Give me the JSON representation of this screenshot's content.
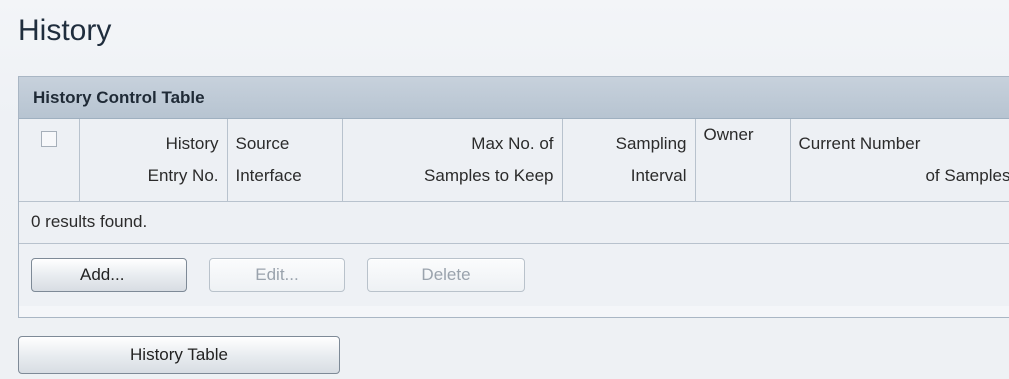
{
  "page": {
    "title": "History"
  },
  "panel": {
    "header": "History Control Table",
    "columns": [
      {
        "line1": "History",
        "line2": "Entry No."
      },
      {
        "line1": "Source",
        "line2": "Interface"
      },
      {
        "line1": "Max No. of",
        "line2": "Samples to Keep"
      },
      {
        "line1": "Sampling",
        "line2": "Interval"
      },
      {
        "line1": "Owner",
        "line2": ""
      },
      {
        "line1": "Current Number",
        "line2": "of Samples"
      }
    ],
    "results_text": "0 results found.",
    "buttons": {
      "add": "Add...",
      "edit": "Edit...",
      "delete": "Delete"
    }
  },
  "footer": {
    "history_table_button": "History Table"
  },
  "colors": {
    "panel_header_bg": "#b7c4d1",
    "disabled_text": "#9aa3ad"
  }
}
